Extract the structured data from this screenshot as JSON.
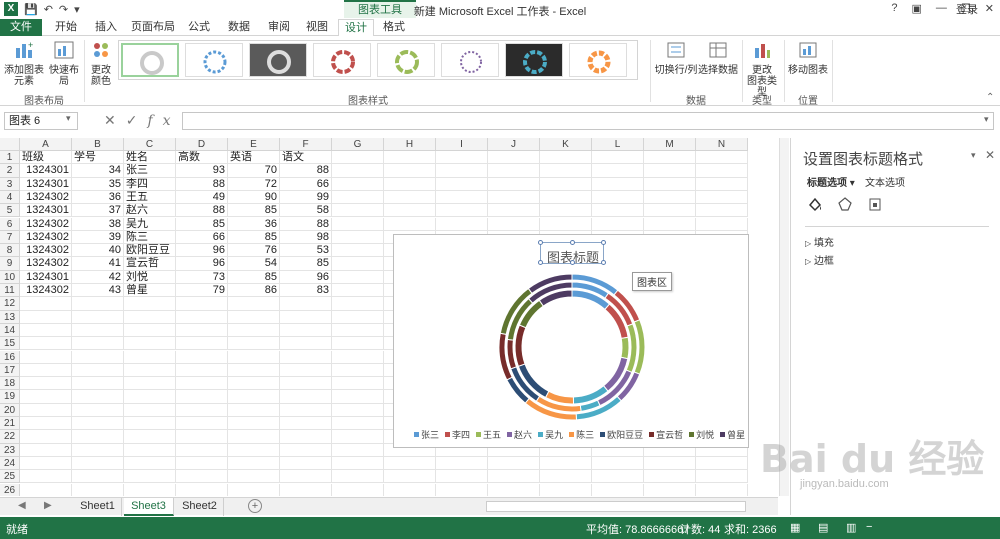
{
  "titlebar": {
    "title": "新建 Microsoft Excel 工作表 - Excel",
    "tools_label": "图表工具",
    "help": "?",
    "login": "登录"
  },
  "tabs": [
    "文件",
    "开始",
    "插入",
    "页面布局",
    "公式",
    "数据",
    "审阅",
    "视图",
    "设计",
    "格式"
  ],
  "active_tab": "设计",
  "ribbon": {
    "add_element": "添加图表\n元素",
    "quick_layout": "快速布局",
    "change_color": "更改\n颜色",
    "group_layout": "图表布局",
    "group_styles": "图表样式",
    "switch_rowcol": "切换行/列",
    "select_data": "选择数据",
    "group_data": "数据",
    "change_type": "更改\n图表类型",
    "group_type": "类型",
    "move_chart": "移动图表",
    "group_location": "位置"
  },
  "formula_bar": {
    "name_box": "图表 6",
    "fx": "fx",
    "value": ""
  },
  "columns": [
    "A",
    "B",
    "C",
    "D",
    "E",
    "F",
    "G",
    "H",
    "I",
    "J",
    "K",
    "L",
    "M",
    "N"
  ],
  "rows": [
    "1",
    "2",
    "3",
    "4",
    "5",
    "6",
    "7",
    "8",
    "9",
    "10",
    "11",
    "12",
    "13",
    "14",
    "15",
    "16",
    "17",
    "18",
    "19",
    "20",
    "21",
    "22",
    "23",
    "24",
    "25",
    "26"
  ],
  "table": {
    "headers": [
      "班级",
      "学号",
      "姓名",
      "高数",
      "英语",
      "语文"
    ],
    "data": [
      [
        "1324301",
        "34",
        "张三",
        "93",
        "70",
        "88"
      ],
      [
        "1324301",
        "35",
        "李四",
        "88",
        "72",
        "66"
      ],
      [
        "1324302",
        "36",
        "王五",
        "49",
        "90",
        "99"
      ],
      [
        "1324301",
        "37",
        "赵六",
        "88",
        "85",
        "58"
      ],
      [
        "1324302",
        "38",
        "吴九",
        "85",
        "36",
        "88"
      ],
      [
        "1324302",
        "39",
        "陈三",
        "66",
        "85",
        "98"
      ],
      [
        "1324302",
        "40",
        "欧阳豆豆",
        "96",
        "76",
        "53"
      ],
      [
        "1324302",
        "41",
        "宣云哲",
        "96",
        "54",
        "85"
      ],
      [
        "1324301",
        "42",
        "刘悦",
        "73",
        "85",
        "96"
      ],
      [
        "1324302",
        "43",
        "曾星",
        "79",
        "86",
        "83"
      ]
    ]
  },
  "chart": {
    "title": "图表标题",
    "tooltip": "图表区"
  },
  "chart_data": {
    "type": "doughnut",
    "categories": [
      "张三",
      "李四",
      "王五",
      "赵六",
      "吴九",
      "陈三",
      "欧阳豆豆",
      "宣云哲",
      "刘悦",
      "曾星"
    ],
    "series": [
      {
        "values": [
          93,
          88,
          49,
          88,
          85,
          66,
          96,
          96,
          73,
          79
        ]
      },
      {
        "values": [
          70,
          72,
          90,
          85,
          36,
          85,
          76,
          54,
          85,
          86
        ]
      },
      {
        "values": [
          88,
          66,
          99,
          58,
          88,
          98,
          53,
          85,
          96,
          83
        ]
      }
    ],
    "colors": [
      "#5b9bd5",
      "#c0504d",
      "#9bbb59",
      "#8064a2",
      "#4bacc6",
      "#f79646",
      "#2c4d75",
      "#772c2a",
      "#5f7530",
      "#4d3b62"
    ],
    "legend_position": "bottom"
  },
  "sheets": [
    "Sheet1",
    "Sheet3",
    "Sheet2"
  ],
  "active_sheet": "Sheet3",
  "panel": {
    "title": "设置图表标题格式",
    "tab_title_options": "标题选项",
    "tab_text_options": "文本选项",
    "section_fill": "填充",
    "section_border": "边框"
  },
  "status": {
    "ready": "就绪",
    "average": "平均值: 78.86666667",
    "count": "计数: 44",
    "sum": "求和: 2366"
  },
  "watermark": {
    "text": "Bai du 经验",
    "url": "jingyan.baidu.com"
  }
}
